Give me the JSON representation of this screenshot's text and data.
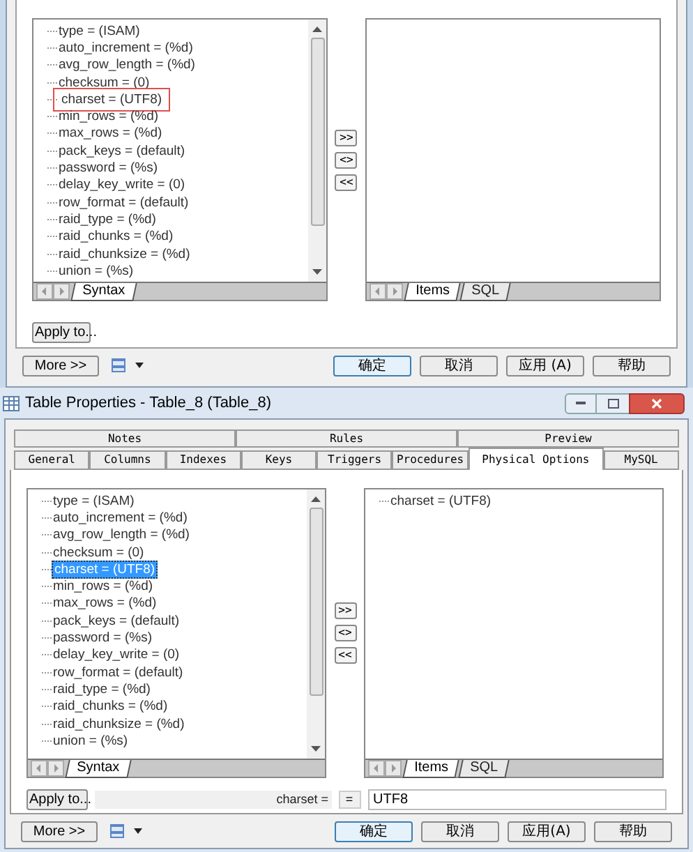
{
  "top_dialog": {
    "syntax_tree": {
      "items": [
        {
          "label": "type = (ISAM)",
          "selected": false,
          "outlined": false
        },
        {
          "label": "auto_increment = (%d)",
          "selected": false,
          "outlined": false
        },
        {
          "label": "avg_row_length = (%d)",
          "selected": false,
          "outlined": false
        },
        {
          "label": "checksum = (0)",
          "selected": false,
          "outlined": false
        },
        {
          "label": "charset = (UTF8)",
          "selected": false,
          "outlined": true
        },
        {
          "label": "min_rows = (%d)",
          "selected": false,
          "outlined": false
        },
        {
          "label": "max_rows = (%d)",
          "selected": false,
          "outlined": false
        },
        {
          "label": "pack_keys = (default)",
          "selected": false,
          "outlined": false
        },
        {
          "label": "password = (%s)",
          "selected": false,
          "outlined": false
        },
        {
          "label": "delay_key_write = (0)",
          "selected": false,
          "outlined": false
        },
        {
          "label": "row_format = (default)",
          "selected": false,
          "outlined": false
        },
        {
          "label": "raid_type = (%d)",
          "selected": false,
          "outlined": false
        },
        {
          "label": "raid_chunks = (%d)",
          "selected": false,
          "outlined": false
        },
        {
          "label": "raid_chunksize = (%d)",
          "selected": false,
          "outlined": false
        },
        {
          "label": "union = (%s)",
          "selected": false,
          "outlined": false
        }
      ],
      "tabs": [
        {
          "label": "Syntax",
          "selected": true
        }
      ]
    },
    "move_buttons": [
      ">>",
      "<>",
      "<<"
    ],
    "items_list": {
      "tabs": [
        {
          "label": "Items",
          "selected": true
        },
        {
          "label": "SQL",
          "selected": false
        }
      ]
    },
    "apply_button": "Apply to...",
    "more_button": "More >>",
    "buttons": [
      "确定",
      "取消",
      "应用 (A)",
      "帮助"
    ]
  },
  "window": {
    "title": "Table Properties - Table_8 (Table_8)",
    "tabs_row_1": [
      {
        "label": "Notes",
        "selected": false
      },
      {
        "label": "Rules",
        "selected": false
      },
      {
        "label": "Preview",
        "selected": false
      }
    ],
    "tabs_row_2": [
      {
        "label": "General",
        "selected": false
      },
      {
        "label": "Columns",
        "selected": false
      },
      {
        "label": "Indexes",
        "selected": false
      },
      {
        "label": "Keys",
        "selected": false
      },
      {
        "label": "Triggers",
        "selected": false
      },
      {
        "label": "Procedures",
        "selected": false
      },
      {
        "label": "Physical Options",
        "selected": true
      },
      {
        "label": "MySQL",
        "selected": false
      }
    ],
    "syntax_tree": {
      "items": [
        {
          "label": "type = (ISAM)",
          "selected": false,
          "outlined": false
        },
        {
          "label": "auto_increment = (%d)",
          "selected": false,
          "outlined": false
        },
        {
          "label": "avg_row_length = (%d)",
          "selected": false,
          "outlined": false
        },
        {
          "label": "checksum = (0)",
          "selected": false,
          "outlined": false
        },
        {
          "label": "charset = (UTF8)",
          "selected": true,
          "outlined": false
        },
        {
          "label": "min_rows = (%d)",
          "selected": false,
          "outlined": false
        },
        {
          "label": "max_rows = (%d)",
          "selected": false,
          "outlined": false
        },
        {
          "label": "pack_keys = (default)",
          "selected": false,
          "outlined": false
        },
        {
          "label": "password = (%s)",
          "selected": false,
          "outlined": false
        },
        {
          "label": "delay_key_write = (0)",
          "selected": false,
          "outlined": false
        },
        {
          "label": "row_format = (default)",
          "selected": false,
          "outlined": false
        },
        {
          "label": "raid_type = (%d)",
          "selected": false,
          "outlined": false
        },
        {
          "label": "raid_chunks = (%d)",
          "selected": false,
          "outlined": false
        },
        {
          "label": "raid_chunksize = (%d)",
          "selected": false,
          "outlined": false
        },
        {
          "label": "union = (%s)",
          "selected": false,
          "outlined": false
        }
      ],
      "tabs": [
        {
          "label": "Syntax",
          "selected": true
        }
      ]
    },
    "move_buttons": [
      ">>",
      "<>",
      "<<"
    ],
    "items_list": {
      "items": [
        {
          "label": "charset = (UTF8)",
          "selected": false,
          "outlined": false
        }
      ],
      "tabs": [
        {
          "label": "Items",
          "selected": true
        },
        {
          "label": "SQL",
          "selected": false
        }
      ]
    },
    "apply_button": "Apply to...",
    "option_label": "charset =",
    "operator": "=",
    "value": "UTF8",
    "more_button": "More >>",
    "buttons": [
      "确定",
      "取消",
      "应用(A)",
      "帮助"
    ]
  }
}
